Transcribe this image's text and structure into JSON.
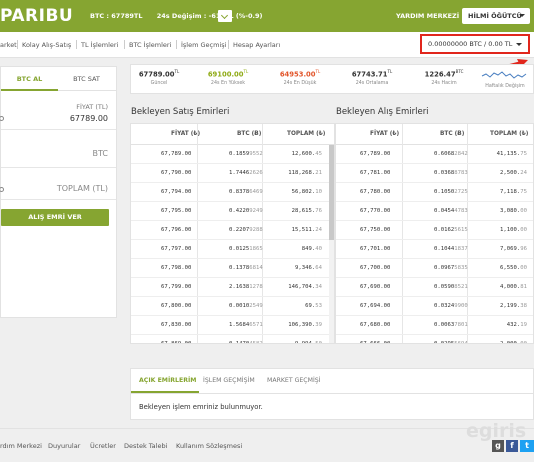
{
  "header": {
    "logo": "PARIBU",
    "ticker_pair": "BTC : 67789TL",
    "ticker_change_label": "24s Değişim :",
    "ticker_change_value": "-6147L (%-0.9)",
    "help_label": "YARDIM MERKEZİ",
    "user_name": "HİLMİ ÖĞÜTCÜ",
    "brand_color": "#86a531"
  },
  "nav": {
    "items": [
      "arket",
      "Kolay Alış-Satış",
      "TL İşlemleri",
      "BTC İşlemleri",
      "İşlem Geçmişi",
      "Hesap Ayarları"
    ],
    "balance": "0.00000000 BTC / 0.00 TL"
  },
  "trade_panel": {
    "tab_buy": "BTC AL",
    "tab_sell": "BTC SAT",
    "price_label": "FİYAT (TL)",
    "price_value": "67789.00",
    "amount_unit": "BTC",
    "total_label": "TOPLAM (TL)",
    "buy_button": "ALIŞ EMRİ VER"
  },
  "stats": [
    {
      "value": "67789.00",
      "unit": "TL",
      "label": "Güncel",
      "color": "#333333"
    },
    {
      "value": "69100.00",
      "unit": "TL",
      "label": "24s En Yüksek",
      "color": "#8faa14"
    },
    {
      "value": "64953.00",
      "unit": "TL",
      "label": "24s En Düşük",
      "color": "#e2552a"
    },
    {
      "value": "67743.71",
      "unit": "TL",
      "label": "24s Ortalama",
      "color": "#333333"
    },
    {
      "value": "1226.47",
      "unit": "BTC",
      "label": "24s Hacim",
      "color": "#333333"
    }
  ],
  "weekly_change_label": "Haftalık Değişim",
  "sell_orders": {
    "title": "Bekleyen Satış Emirleri",
    "columns": [
      "FİYAT (₺)",
      "BTC (Ƀ)",
      "TOPLAM (₺)"
    ],
    "rows": [
      [
        "67,789.00",
        "0.1859",
        "9552",
        "12,600.",
        "45"
      ],
      [
        "67,790.00",
        "1.7446",
        "2626",
        "118,268.",
        "21"
      ],
      [
        "67,794.00",
        "0.8378",
        "6469",
        "56,802.",
        "10"
      ],
      [
        "67,795.00",
        "0.4220",
        "9249",
        "28,615.",
        "76"
      ],
      [
        "67,796.00",
        "0.2207",
        "9288",
        "15,511.",
        "24"
      ],
      [
        "67,797.00",
        "0.0125",
        "1865",
        "849.",
        "40"
      ],
      [
        "67,798.00",
        "0.1378",
        "6814",
        "9,346.",
        "64"
      ],
      [
        "67,799.00",
        "2.1638",
        "1278",
        "146,704.",
        "34"
      ],
      [
        "67,800.00",
        "0.0010",
        "2549",
        "69.",
        "53"
      ],
      [
        "67,830.00",
        "1.5684",
        "6571",
        "106,390.",
        "39"
      ],
      [
        "67,869.00",
        "0.1470",
        "4582",
        "9,994.",
        "50"
      ]
    ]
  },
  "buy_orders": {
    "title": "Bekleyen Alış Emirleri",
    "columns": [
      "FİYAT (₺)",
      "BTC (Ƀ)",
      "TOPLAM (₺)"
    ],
    "rows": [
      [
        "67,789.00",
        "0.6068",
        "2842",
        "41,135.",
        "75"
      ],
      [
        "67,781.00",
        "0.0368",
        "8783",
        "2,500.",
        "24"
      ],
      [
        "67,780.00",
        "0.1050",
        "2725",
        "7,118.",
        "75"
      ],
      [
        "67,770.00",
        "0.0454",
        "4783",
        "3,080.",
        "00"
      ],
      [
        "67,750.00",
        "0.0162",
        "5615",
        "1,100.",
        "00"
      ],
      [
        "67,701.00",
        "0.1044",
        "1837",
        "7,069.",
        "96"
      ],
      [
        "67,700.00",
        "0.0967",
        "5835",
        "6,550.",
        "00"
      ],
      [
        "67,690.00",
        "0.0590",
        "8521",
        "4,000.",
        "81"
      ],
      [
        "67,694.00",
        "0.0324",
        "9900",
        "2,199.",
        "38"
      ],
      [
        "67,680.00",
        "0.0063",
        "7801",
        "432.",
        "19"
      ],
      [
        "67,666.00",
        "0.0295",
        "5694",
        "2,000.",
        "00"
      ]
    ]
  },
  "open_orders": {
    "tabs": [
      "AÇIK EMİRLERİM",
      "İŞLEM GEÇMİŞİM",
      "MARKET GEÇMİŞİ"
    ],
    "empty_message": "Bekleyen işlem emriniz bulunmuyor."
  },
  "footer": {
    "links": [
      "rdım Merkezi",
      "Duyurular",
      "Ücretler",
      "Destek Talebi",
      "Kullanım Sözleşmesi"
    ],
    "watermark": "egiris"
  }
}
